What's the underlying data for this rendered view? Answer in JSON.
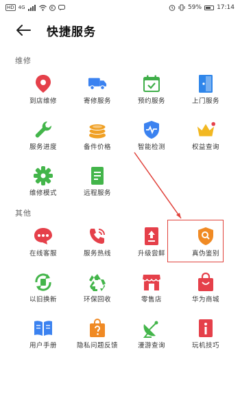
{
  "status_bar": {
    "network_label": "HD",
    "signal_label": "4G",
    "battery_percent": "59%",
    "time": "17:14"
  },
  "header": {
    "title": "快捷服务",
    "back_icon": "arrow-left-icon"
  },
  "sections": [
    {
      "title": "维修",
      "items": [
        {
          "label": "到店维修",
          "icon": "location-pin-icon",
          "color": "#e5404a"
        },
        {
          "label": "寄修服务",
          "icon": "delivery-truck-icon",
          "color": "#3b82f0"
        },
        {
          "label": "预约服务",
          "icon": "calendar-check-icon",
          "color": "#3fae49"
        },
        {
          "label": "上门服务",
          "icon": "door-icon",
          "color": "#2f86ea"
        },
        {
          "label": "服务进度",
          "icon": "wrench-icon",
          "color": "#43b54a"
        },
        {
          "label": "备件价格",
          "icon": "coins-icon",
          "color": "#f0a024"
        },
        {
          "label": "智能检测",
          "icon": "shield-pulse-icon",
          "color": "#3b82f0"
        },
        {
          "label": "权益查询",
          "icon": "crown-icon",
          "color": "#f2b822"
        },
        {
          "label": "维修模式",
          "icon": "gear-icon",
          "color": "#43b54a"
        },
        {
          "label": "远程服务",
          "icon": "phone-remote-icon",
          "color": "#43b54a"
        }
      ]
    },
    {
      "title": "其他",
      "items": [
        {
          "label": "在线客服",
          "icon": "chat-bubble-icon",
          "color": "#e5404a"
        },
        {
          "label": "服务热线",
          "icon": "phone-call-icon",
          "color": "#e5404a"
        },
        {
          "label": "升级尝鲜",
          "icon": "upgrade-icon",
          "color": "#e5404a"
        },
        {
          "label": "真伪鉴别",
          "icon": "shield-search-icon",
          "color": "#f08a24"
        },
        {
          "label": "以旧换新",
          "icon": "trade-in-icon",
          "color": "#43b54a"
        },
        {
          "label": "环保回收",
          "icon": "recycle-icon",
          "color": "#43b54a"
        },
        {
          "label": "零售店",
          "icon": "store-icon",
          "color": "#e5404a"
        },
        {
          "label": "华为商城",
          "icon": "shopping-bag-icon",
          "color": "#e5404a"
        },
        {
          "label": "用户手册",
          "icon": "book-icon",
          "color": "#3b82f0"
        },
        {
          "label": "隐私问题反馈",
          "icon": "question-bag-icon",
          "color": "#f08a24"
        },
        {
          "label": "漫游查询",
          "icon": "satellite-dish-icon",
          "color": "#43b54a"
        },
        {
          "label": "玩机技巧",
          "icon": "info-book-icon",
          "color": "#e5404a"
        }
      ]
    }
  ],
  "colors": {
    "highlight": "#e0413a",
    "text": "#333333",
    "section_title": "#666666"
  }
}
